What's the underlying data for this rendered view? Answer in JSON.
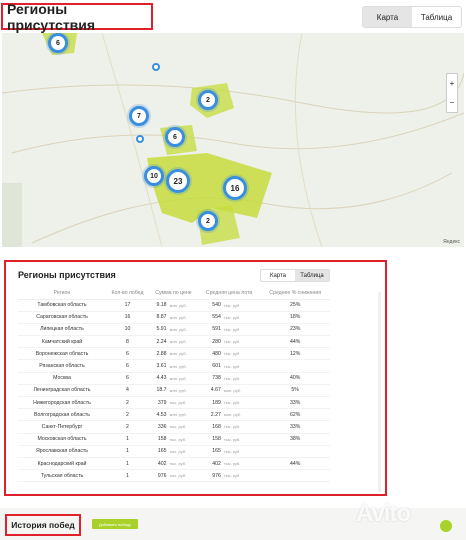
{
  "header": {
    "title": "Регионы присутствия",
    "tabs": [
      {
        "label": "Карта",
        "active": true
      },
      {
        "label": "Таблица",
        "active": false
      }
    ]
  },
  "map": {
    "markers": [
      "6",
      "2",
      "7",
      "6",
      "10",
      "23",
      "16",
      "2"
    ],
    "credit": "Яндекс",
    "zoom_in": "+",
    "zoom_out": "−",
    "highlight_color": "#c5dc3c"
  },
  "table_panel": {
    "title": "Регионы присутствия",
    "tabs": [
      {
        "label": "Карта",
        "active": false
      },
      {
        "label": "Таблица",
        "active": true
      }
    ],
    "columns": [
      "Регион",
      "Кол-во побед",
      "Сумма по цене",
      "Средняя цена лота",
      "Среднее % снижения"
    ],
    "rows": [
      {
        "region": "Тамбовская область",
        "wins": "17",
        "sum": "9.18",
        "sum_unit": "млн. руб.",
        "avg": "540",
        "avg_unit": "тыс. руб.",
        "pct": "25%"
      },
      {
        "region": "Саратовская область",
        "wins": "16",
        "sum": "8.87",
        "sum_unit": "млн. руб.",
        "avg": "554",
        "avg_unit": "тыс. руб.",
        "pct": "18%"
      },
      {
        "region": "Липецкая область",
        "wins": "10",
        "sum": "5.91",
        "sum_unit": "млн. руб.",
        "avg": "591",
        "avg_unit": "тыс. руб.",
        "pct": "23%"
      },
      {
        "region": "Камчатский край",
        "wins": "8",
        "sum": "2.24",
        "sum_unit": "млн. руб.",
        "avg": "280",
        "avg_unit": "тыс. руб.",
        "pct": "44%"
      },
      {
        "region": "Воронежская область",
        "wins": "6",
        "sum": "2.88",
        "sum_unit": "млн. руб.",
        "avg": "480",
        "avg_unit": "тыс. руб.",
        "pct": "12%"
      },
      {
        "region": "Рязанская область",
        "wins": "6",
        "sum": "3.61",
        "sum_unit": "млн. руб.",
        "avg": "601",
        "avg_unit": "тыс. руб.",
        "pct": ""
      },
      {
        "region": "Москва",
        "wins": "6",
        "sum": "4.43",
        "sum_unit": "млн. руб.",
        "avg": "738",
        "avg_unit": "тыс. руб.",
        "pct": "40%"
      },
      {
        "region": "Ленинградская область",
        "wins": "4",
        "sum": "18.7",
        "sum_unit": "млн. руб.",
        "avg": "4.67",
        "avg_unit": "млн. руб.",
        "pct": "5%"
      },
      {
        "region": "Нижегородская область",
        "wins": "2",
        "sum": "379",
        "sum_unit": "тыс. руб.",
        "avg": "189",
        "avg_unit": "тыс. руб.",
        "pct": "33%"
      },
      {
        "region": "Волгоградская область",
        "wins": "2",
        "sum": "4.53",
        "sum_unit": "млн. руб.",
        "avg": "2.27",
        "avg_unit": "млн. руб.",
        "pct": "62%"
      },
      {
        "region": "Санкт-Петербург",
        "wins": "2",
        "sum": "336",
        "sum_unit": "тыс. руб.",
        "avg": "168",
        "avg_unit": "тыс. руб.",
        "pct": "33%"
      },
      {
        "region": "Московская область",
        "wins": "1",
        "sum": "158",
        "sum_unit": "тыс. руб.",
        "avg": "158",
        "avg_unit": "тыс. руб.",
        "pct": "38%"
      },
      {
        "region": "Ярославская область",
        "wins": "1",
        "sum": "165",
        "sum_unit": "тыс. руб.",
        "avg": "165",
        "avg_unit": "тыс. руб.",
        "pct": ""
      },
      {
        "region": "Краснодарский край",
        "wins": "1",
        "sum": "402",
        "sum_unit": "тыс. руб.",
        "avg": "402",
        "avg_unit": "тыс. руб.",
        "pct": "44%"
      },
      {
        "region": "Тульская область",
        "wins": "1",
        "sum": "976",
        "sum_unit": "тыс. руб.",
        "avg": "976",
        "avg_unit": "тыс. руб.",
        "pct": ""
      }
    ]
  },
  "footer": {
    "history_title": "История побед",
    "add_button": "Добавить победу",
    "watermark": "Avito"
  },
  "colors": {
    "highlight_border": "#e0202a",
    "marker_blue": "#3a8ee0",
    "accent_green": "#a8d22a"
  }
}
